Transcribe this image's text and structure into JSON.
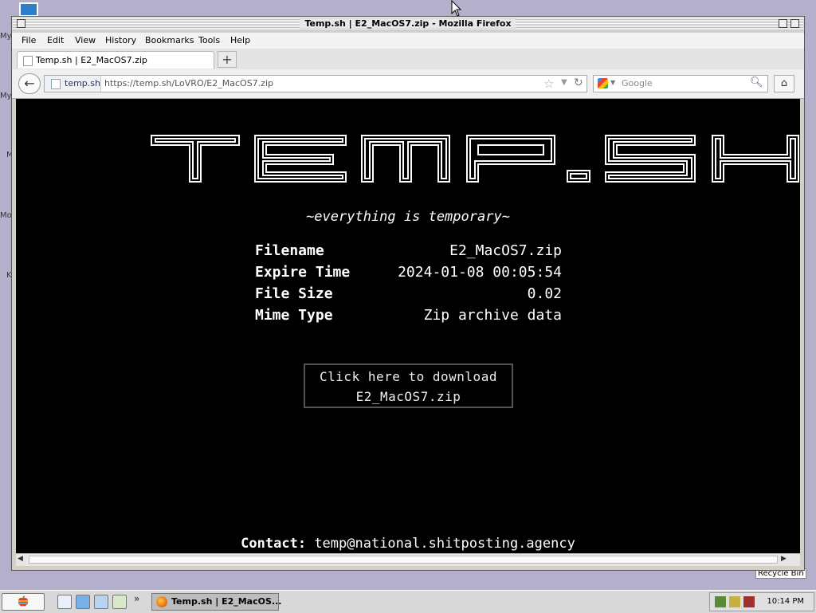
{
  "window": {
    "title": "Temp.sh | E2_MacOS7.zip - Mozilla Firefox"
  },
  "menu": {
    "file": "File",
    "edit": "Edit",
    "view": "View",
    "history": "History",
    "bookmarks": "Bookmarks",
    "tools": "Tools",
    "help": "Help"
  },
  "tabs": [
    {
      "label": "Temp.sh | E2_MacOS7.zip"
    }
  ],
  "new_tab_label": "+",
  "navbar": {
    "identity": "temp.sh",
    "url": "https://temp.sh/LoVRO/E2_MacOS7.zip",
    "search_placeholder": "Google"
  },
  "page": {
    "logo_text": "TEMP.SH",
    "tagline": "~everything is temporary~",
    "info": [
      {
        "key": "Filename",
        "value": "E2_MacOS7.zip"
      },
      {
        "key": "Expire Time",
        "value": "2024-01-08 00:05:54"
      },
      {
        "key": "File Size",
        "value": "0.02"
      },
      {
        "key": "Mime Type",
        "value": "Zip archive data"
      }
    ],
    "download": {
      "line1": "Click here to download",
      "line2": "E2_MacOS7.zip"
    },
    "contact_label": "Contact:",
    "contact_email": "temp@national.shitposting.agency"
  },
  "desktop": {
    "recycle_bin": "Recycle Bin",
    "left_labels": [
      "My",
      "My",
      "M",
      "Mo",
      "K"
    ]
  },
  "taskbar": {
    "task_label": "Temp.sh | E2_MacOS...",
    "more": "»",
    "clock": "10:14 PM"
  },
  "colors": {
    "desktop": "#b4b0cc",
    "page_bg": "#000000",
    "page_text": "#ffffff"
  }
}
